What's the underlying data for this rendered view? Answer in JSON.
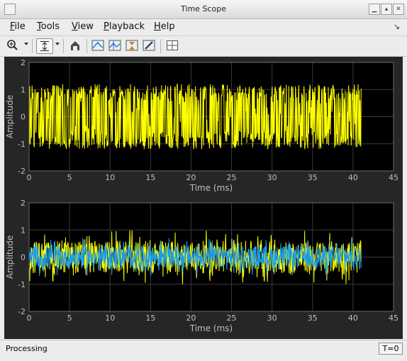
{
  "window": {
    "title": "Time Scope"
  },
  "menu": {
    "items": [
      {
        "first": "F",
        "rest": "ile"
      },
      {
        "first": "T",
        "rest": "ools"
      },
      {
        "first": "V",
        "rest": "iew"
      },
      {
        "first": "P",
        "rest": "layback"
      },
      {
        "first": "H",
        "rest": "elp"
      }
    ]
  },
  "toolbar": {
    "icons": [
      "zoom-in-icon",
      "zoom-dropdown-icon",
      "autoscale-icon",
      "autoscale-dropdown-icon",
      "restore-icon",
      "signal-triggers-icon",
      "cursor-measurements-icon",
      "peak-finder-icon",
      "style-icon",
      "layout-icon"
    ]
  },
  "colors": {
    "series_yellow": "#ffff00",
    "series_blue": "#1a9be8",
    "plot_bg": "#000000",
    "frame_bg": "#262626",
    "axis_text": "#bfbfbf"
  },
  "chart_data": [
    {
      "type": "line",
      "xlabel": "Time (ms)",
      "ylabel": "Amplitude",
      "xlim": [
        0,
        45
      ],
      "ylim": [
        -2,
        2
      ],
      "x_ticks": [
        "0",
        "5",
        "10",
        "15",
        "20",
        "25",
        "30",
        "35",
        "40",
        "45"
      ],
      "y_ticks": [
        "2",
        "1",
        "0",
        "-1",
        "-2"
      ],
      "grid": true,
      "series": [
        {
          "color": "#ffff00",
          "x_range": [
            0,
            41
          ],
          "amplitude_min": -1.2,
          "amplitude_max": 1.2
        }
      ]
    },
    {
      "type": "line",
      "xlabel": "Time (ms)",
      "ylabel": "Amplitude",
      "xlim": [
        0,
        45
      ],
      "ylim": [
        -2,
        2
      ],
      "x_ticks": [
        "0",
        "5",
        "10",
        "15",
        "20",
        "25",
        "30",
        "35",
        "40",
        "45"
      ],
      "y_ticks": [
        "2",
        "1",
        "0",
        "-1",
        "-2"
      ],
      "grid": true,
      "series": [
        {
          "color": "#ffff00",
          "x_range": [
            0,
            41
          ],
          "amplitude_min": -1.0,
          "amplitude_max": 1.0
        },
        {
          "color": "#1a9be8",
          "x_range": [
            0,
            41
          ],
          "amplitude_min": -0.7,
          "amplitude_max": 0.7
        }
      ]
    }
  ],
  "status": {
    "text": "Processing",
    "time": "T=0"
  }
}
